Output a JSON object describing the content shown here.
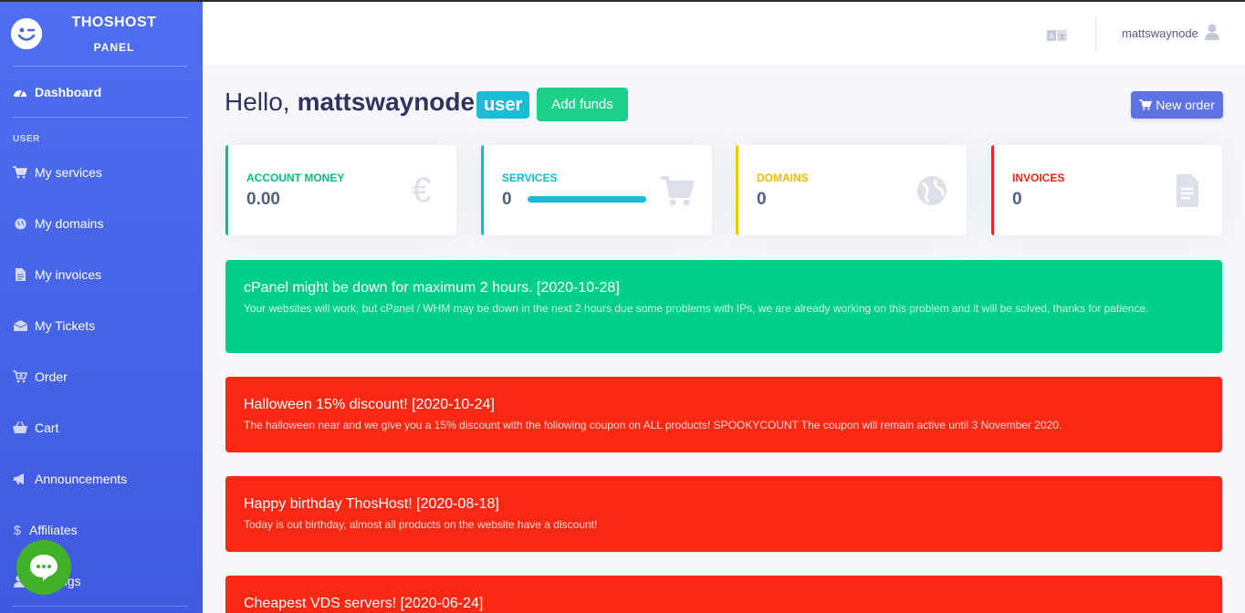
{
  "brand": {
    "title": "THOSHOST",
    "subtitle": "PANEL"
  },
  "sidebar": {
    "dashboard": "Dashboard",
    "section_label": "USER",
    "items": [
      {
        "label": "My services",
        "icon": "cart-icon"
      },
      {
        "label": "My domains",
        "icon": "globe-icon"
      },
      {
        "label": "My invoices",
        "icon": "file-icon"
      },
      {
        "label": "My Tickets",
        "icon": "box-icon"
      },
      {
        "label": "Order",
        "icon": "cart-plus-icon"
      },
      {
        "label": "Cart",
        "icon": "basket-icon"
      },
      {
        "label": "Announcements",
        "icon": "megaphone-icon"
      },
      {
        "label": "Affiliates",
        "icon": "dollar-icon"
      },
      {
        "label": "Settings",
        "icon": "user-cog-icon"
      }
    ]
  },
  "topbar": {
    "username": "mattswaynode",
    "language_icon": "translate-icon",
    "user_icon": "user-icon"
  },
  "greeting": {
    "hello": "Hello,",
    "name": "mattswaynode",
    "role_badge": "user",
    "add_funds": "Add funds",
    "new_order": "New order"
  },
  "cards": [
    {
      "label": "ACCOUNT MONEY",
      "value": "0.00",
      "color": "#00c07f",
      "icon": "euro-icon"
    },
    {
      "label": "SERVICES",
      "value": "0",
      "color": "#11bcd4",
      "icon": "cart-icon",
      "progress": 1.0
    },
    {
      "label": "DOMAINS",
      "value": "0",
      "color": "#f5c400",
      "icon": "globe-icon"
    },
    {
      "label": "INVOICES",
      "value": "0",
      "color": "#f5230f",
      "icon": "file-icon"
    }
  ],
  "announcements": [
    {
      "title": "cPanel might be down for maximum 2 hours. [2020-10-28]",
      "text": "Your websites will work, but cPanel / WHM may be down in the next 2 hours due some problems with IPs, we are already working on this problem and it will be solved, thanks for patience.",
      "color": "green"
    },
    {
      "title": "Halloween 15% discount! [2020-10-24]",
      "text": "The halloween near and we give you a 15% discount with the following coupon on ALL products! SPOOKYCOUNT The coupon will remain active until 3 November 2020.",
      "color": "red"
    },
    {
      "title": "Happy birthday ThosHost! [2020-08-18]",
      "text": "Today is out birthday, almost all products on the website have a discount!",
      "color": "red"
    },
    {
      "title": "Cheapest VDS servers! [2020-06-24]",
      "text": "",
      "color": "red"
    }
  ],
  "chat": {
    "icon": "chat-bubble-icon"
  }
}
